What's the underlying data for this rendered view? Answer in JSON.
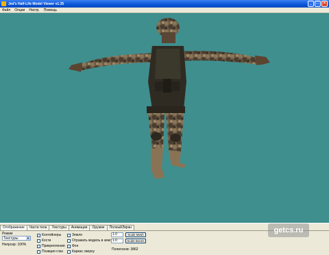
{
  "window": {
    "title": "Jed's Half-Life Model Viewer v1.35"
  },
  "menu": [
    "Файл",
    "Опции",
    "Настр.",
    "Помощь"
  ],
  "tabs": [
    "Отображение",
    "Части тела",
    "Текстуры",
    "Анимации",
    "Оружие",
    "ПолныйЭкран"
  ],
  "panel": {
    "mode_label": "Режим",
    "mode_value": "Текстуры",
    "opacity_label": "Непрозр: 100%",
    "checkboxes_col1": [
      "Контейнеры",
      "Кости",
      "Прикрепления",
      "Позиция глаз"
    ],
    "checkboxes_col2": [
      "Земля",
      "Отражать модель в земле",
      "Фон",
      "Каркас сверху"
    ],
    "scale_mesh_value": "1.0",
    "scale_bones_value": "1.0",
    "scale_mesh_button": "Scale Mesh",
    "scale_bones_button": "Scale Bones",
    "polygons_label": "Полигонов: 3862"
  },
  "watermark": "getcs.ru",
  "colors": {
    "viewport_background": "#3f8f8f",
    "titlebar": "#0a55d6",
    "panel": "#ece9d8"
  },
  "icons": [
    "app-icon",
    "minimize-icon",
    "maximize-icon",
    "close-icon"
  ]
}
